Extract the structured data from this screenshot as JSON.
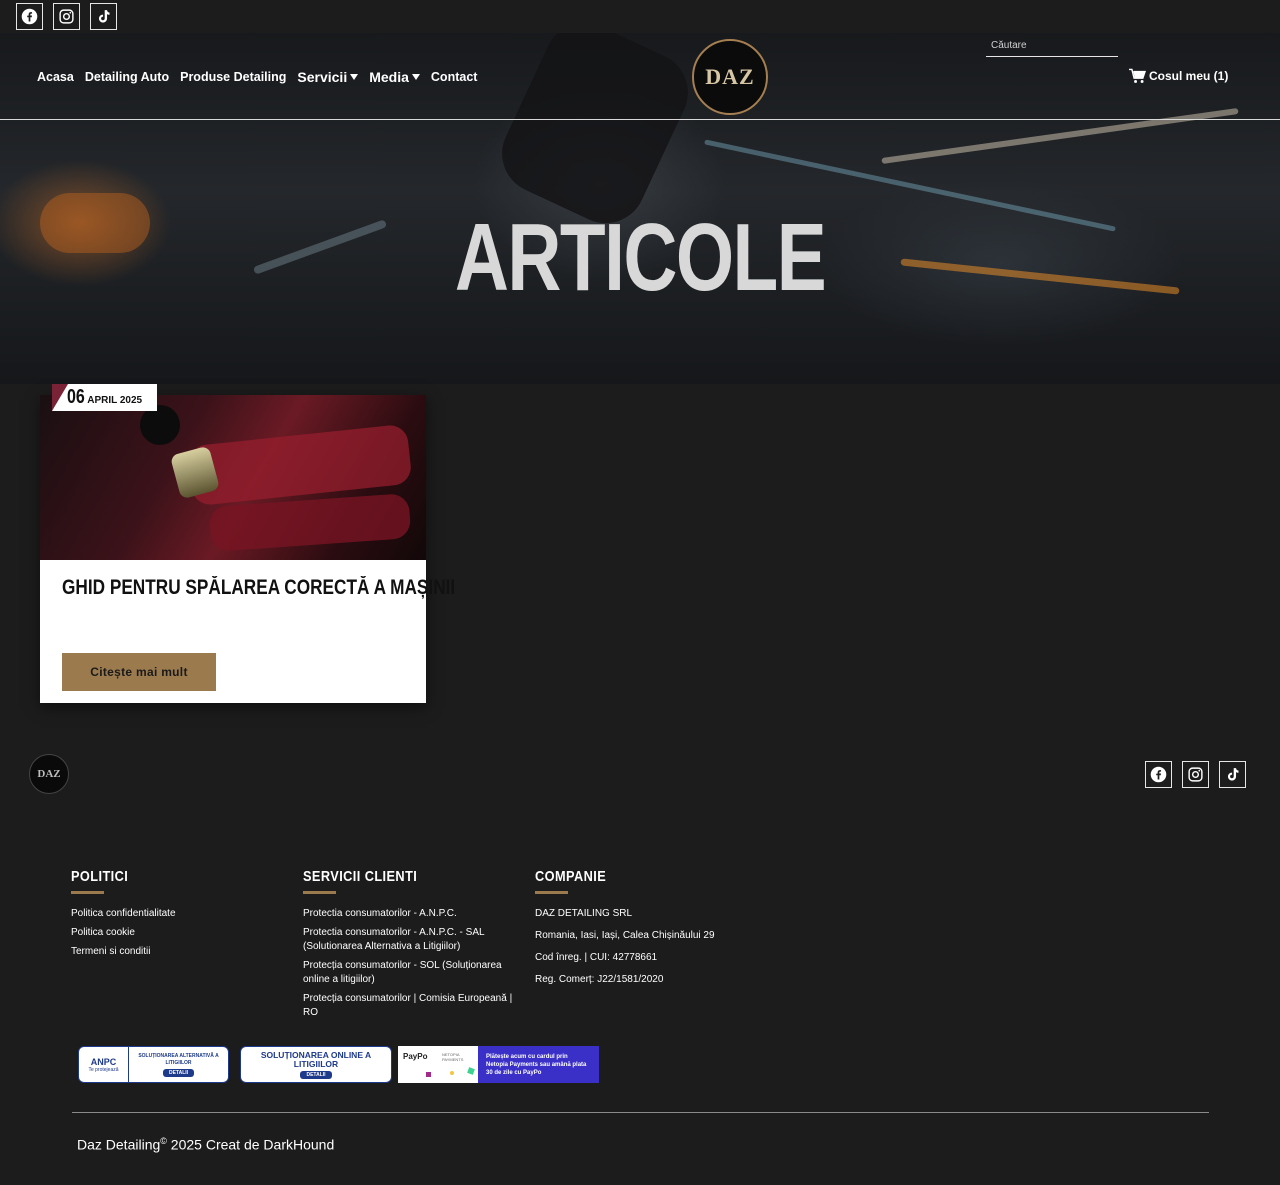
{
  "top_social": {
    "icons": [
      "facebook-icon",
      "instagram-icon",
      "tiktok-icon"
    ]
  },
  "nav": {
    "items": [
      {
        "label": "Acasa",
        "dropdown": false
      },
      {
        "label": "Detailing Auto",
        "dropdown": false
      },
      {
        "label": "Produse Detailing",
        "dropdown": false
      },
      {
        "label": "Servicii",
        "dropdown": true
      },
      {
        "label": "Media",
        "dropdown": true
      },
      {
        "label": "Contact",
        "dropdown": false
      }
    ],
    "logo_text": "DAZ",
    "search_placeholder": "Căutare",
    "cart_label": "Cosul meu (1)"
  },
  "hero": {
    "title": "ARTICOLE"
  },
  "article": {
    "date_day": "06",
    "date_month_year": "APRIL 2025",
    "title": "GHID PENTRU SPĂLAREA CORECTĂ A MAȘINII",
    "button_label": "Citește mai mult"
  },
  "footer": {
    "logo_text": "DAZ",
    "columns": {
      "politici": {
        "heading": "POLITICI",
        "links": [
          "Politica confidentialitate",
          "Politica cookie",
          "Termeni si conditii"
        ]
      },
      "servicii": {
        "heading": "SERVICII CLIENTI",
        "links": [
          "Protectia consumatorilor - A.N.P.C.",
          "Protectia consumatorilor - A.N.P.C. - SAL (Solutionarea Alternativa a Litigiilor)",
          "Protecția consumatorilor - SOL (Soluționarea online a litigiilor)",
          "Protecția consumatorilor | Comisia Europeană | RO"
        ]
      },
      "companie": {
        "heading": "COMPANIE",
        "lines": [
          "DAZ DETAILING SRL",
          "Romania, Iasi, Iași, Calea Chișinăului 29",
          "Cod înreg. | CUI: 42778661",
          "Reg. Comerț: J22/1581/2020"
        ]
      }
    },
    "badges": {
      "anpc_short": "ANPC",
      "anpc_sub": "Te protejează",
      "sal_text": "SOLUȚIONAREA ALTERNATIVĂ A LITIGIILOR",
      "details": "DETALII",
      "sol_text": "SOLUȚIONAREA ONLINE A LITIGIILOR",
      "paypo_brand": "PayPo",
      "netopia_brand": "NETOPIA PAYMENTS",
      "paypo_text": "Plătește acum cu cardul prin Netopia Payments sau amână plata 30 de zile cu PayPo"
    },
    "copyright_brand": "Daz Detailing",
    "copyright_mark": "©",
    "copyright_rest": " 2025 Creat de DarkHound"
  },
  "colors": {
    "background": "#1c1c1d",
    "accent": "#9b7a4e",
    "date_corner": "#7b2336"
  }
}
